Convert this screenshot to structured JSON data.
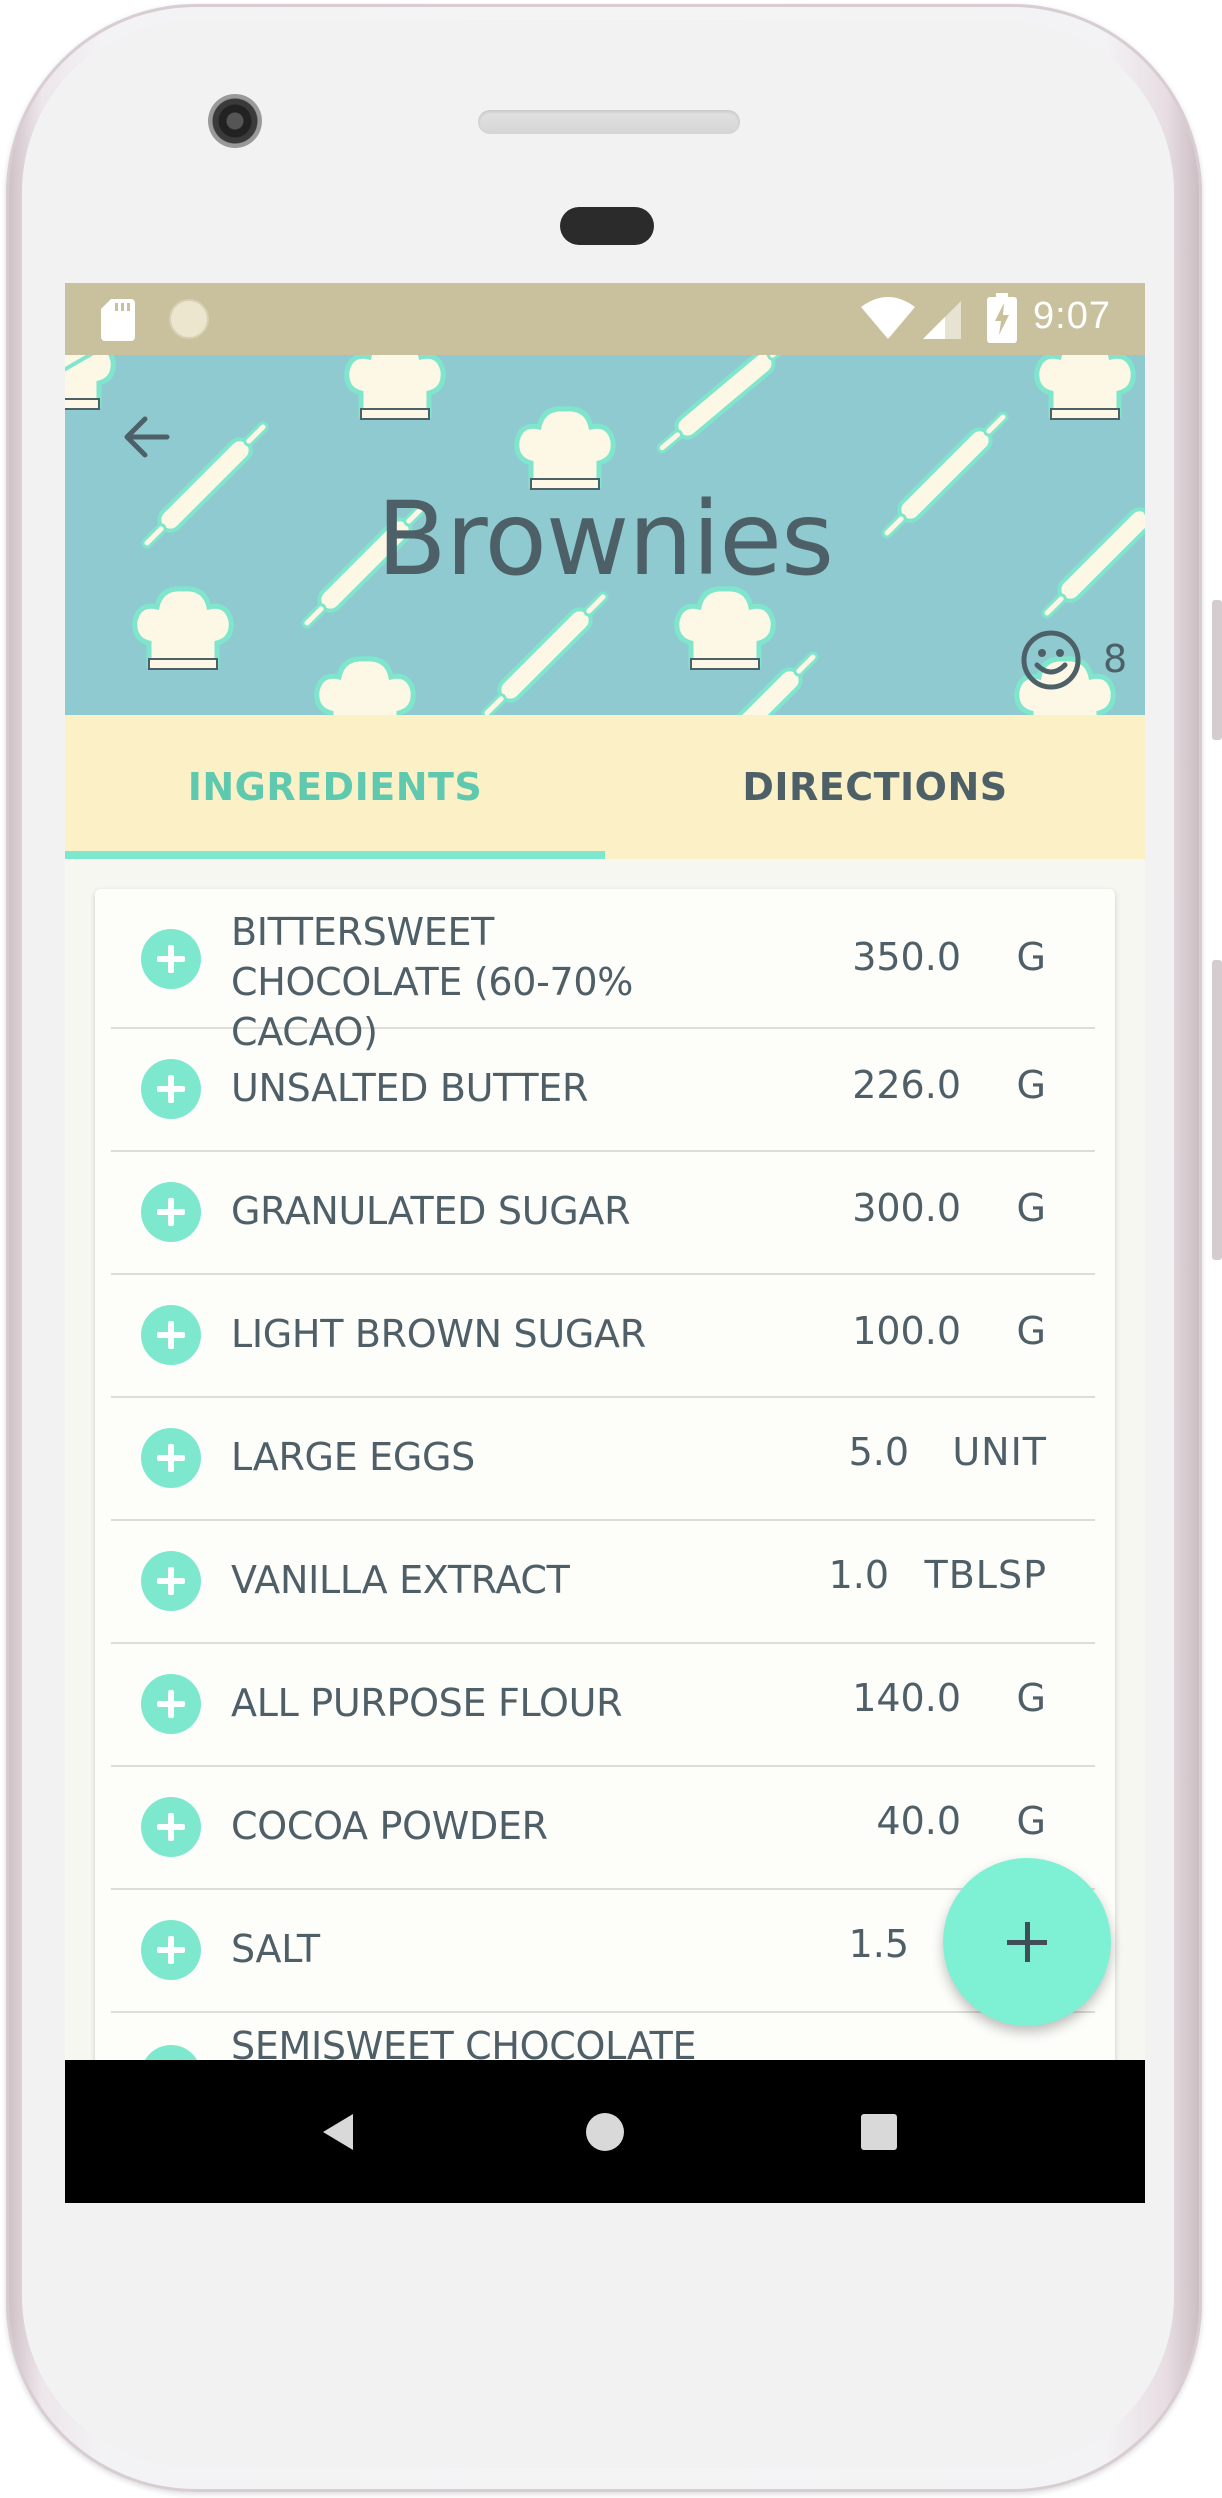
{
  "status_bar": {
    "time": "9:07"
  },
  "header": {
    "title": "Brownies",
    "servings": "8"
  },
  "tabs": {
    "ingredients_label": "INGREDIENTS",
    "directions_label": "DIRECTIONS",
    "active": "INGREDIENTS"
  },
  "ingredients": [
    {
      "name": "BITTERSWEET CHOCOLATE (60-70% CACAO)",
      "quantity": "350.0",
      "unit": "G"
    },
    {
      "name": "UNSALTED BUTTER",
      "quantity": "226.0",
      "unit": "G"
    },
    {
      "name": "GRANULATED SUGAR",
      "quantity": "300.0",
      "unit": "G"
    },
    {
      "name": "LIGHT BROWN SUGAR",
      "quantity": "100.0",
      "unit": "G"
    },
    {
      "name": "LARGE EGGS",
      "quantity": "5.0",
      "unit": "UNIT"
    },
    {
      "name": "VANILLA EXTRACT",
      "quantity": "1.0",
      "unit": "TBLSP"
    },
    {
      "name": "ALL PURPOSE FLOUR",
      "quantity": "140.0",
      "unit": "G"
    },
    {
      "name": "COCOA POWDER",
      "quantity": "40.0",
      "unit": "G"
    },
    {
      "name": "SALT",
      "quantity": "1.5",
      "unit": ""
    },
    {
      "name": "SEMISWEET CHOCOLATE",
      "quantity": "",
      "unit": ""
    }
  ],
  "colors": {
    "status_bar": "#c9c19e",
    "header_bg": "#8fcad0",
    "tab_bg": "#fcf0c6",
    "accent": "#7ee8cf",
    "text": "#4f5f68"
  },
  "icons": {
    "back": "arrow-left-icon",
    "servings": "smiley-face-icon",
    "add_ingredient": "plus-circle-icon",
    "fab": "plus-icon",
    "nav_back": "triangle-back-icon",
    "nav_home": "circle-home-icon",
    "nav_recents": "square-recents-icon"
  }
}
